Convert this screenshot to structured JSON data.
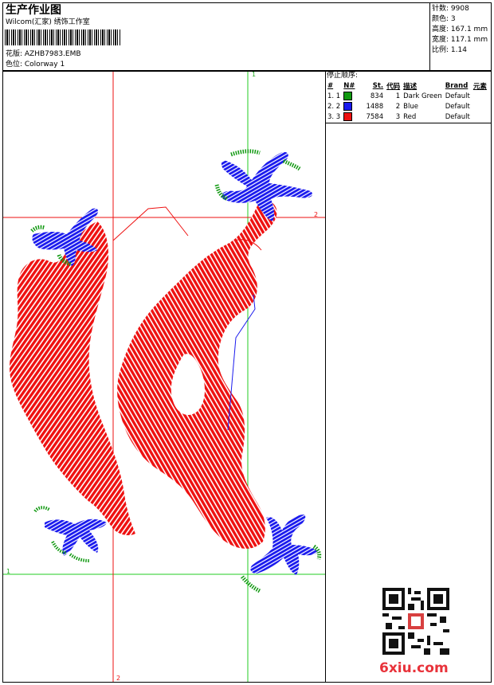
{
  "header": {
    "title": "生产作业图",
    "company": "Wilcom(汇家) 绣饰工作室",
    "design_label": "花版: AZHB7983.EMB",
    "colorway_label": "色位: Colorway 1",
    "stats": [
      {
        "label": "针数",
        "value": "9908"
      },
      {
        "label": "颜色",
        "value": "3"
      },
      {
        "label": "高度",
        "value": "167.1 mm"
      },
      {
        "label": "宽度",
        "value": "117.1 mm"
      },
      {
        "label": "比例",
        "value": "1.14"
      }
    ]
  },
  "stop_sequence": {
    "title": "停止顺序:",
    "columns": [
      "#",
      "N#",
      "St.",
      "代码",
      "描述",
      "Brand",
      "元素"
    ],
    "rows": [
      {
        "index": "1. 1",
        "color": "#119911",
        "st": "834",
        "code": "1",
        "desc": "Dark Green",
        "brand": "Default"
      },
      {
        "index": "2. 2",
        "color": "#1a1aee",
        "st": "1488",
        "code": "2",
        "desc": "Blue",
        "brand": "Default"
      },
      {
        "index": "3. 3",
        "color": "#ee1111",
        "st": "7584",
        "code": "3",
        "desc": "Red",
        "brand": "Default"
      }
    ]
  },
  "guides": {
    "green_v": "1",
    "green_h": "1",
    "red_h": "2",
    "red_v": "2"
  },
  "colors": {
    "red": "#ee1111",
    "blue": "#1a1aee",
    "green": "#119911"
  },
  "watermark": "6xiu.com"
}
